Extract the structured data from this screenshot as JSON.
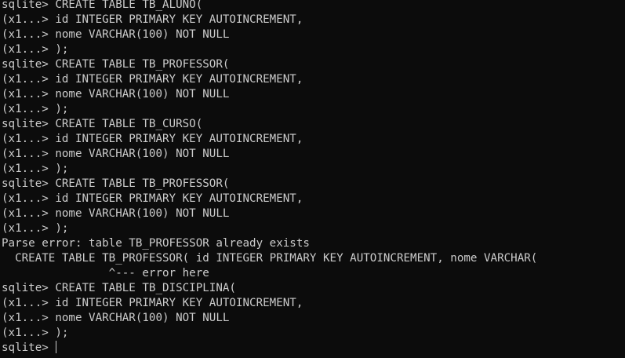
{
  "terminal": {
    "lines": [
      "sqlite> CREATE TABLE TB_ALUNO(",
      "(x1...> id INTEGER PRIMARY KEY AUTOINCREMENT,",
      "(x1...> nome VARCHAR(100) NOT NULL",
      "(x1...> );",
      "sqlite> CREATE TABLE TB_PROFESSOR(",
      "(x1...> id INTEGER PRIMARY KEY AUTOINCREMENT,",
      "(x1...> nome VARCHAR(100) NOT NULL",
      "(x1...> );",
      "sqlite> CREATE TABLE TB_CURSO(",
      "(x1...> id INTEGER PRIMARY KEY AUTOINCREMENT,",
      "(x1...> nome VARCHAR(100) NOT NULL",
      "(x1...> );",
      "sqlite> CREATE TABLE TB_PROFESSOR(",
      "(x1...> id INTEGER PRIMARY KEY AUTOINCREMENT,",
      "(x1...> nome VARCHAR(100) NOT NULL",
      "(x1...> );",
      "Parse error: table TB_PROFESSOR already exists",
      "  CREATE TABLE TB_PROFESSOR( id INTEGER PRIMARY KEY AUTOINCREMENT, nome VARCHAR(",
      "                ^--- error here",
      "sqlite> CREATE TABLE TB_DISCIPLINA(",
      "(x1...> id INTEGER PRIMARY KEY AUTOINCREMENT,",
      "(x1...> nome VARCHAR(100) NOT NULL",
      "(x1...> );"
    ],
    "prompt": "sqlite> ",
    "colors": {
      "background": "#0c0c0c",
      "foreground": "#cccccc"
    }
  }
}
